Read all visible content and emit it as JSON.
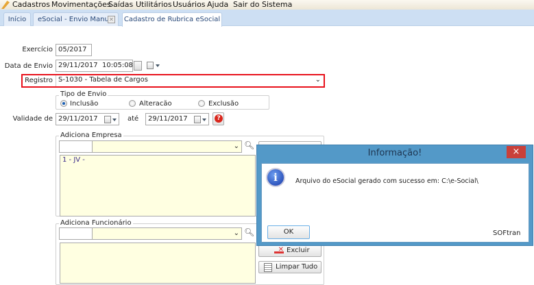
{
  "menu": [
    "Cadastros",
    "Movimentações",
    "Saídas",
    "Utilitários",
    "Usuários",
    "Ajuda",
    "Sair do Sistema"
  ],
  "tabs": [
    {
      "label": "Início"
    },
    {
      "label": "eSocial - Envio Manual"
    },
    {
      "label": "Cadastro de Rubrica eSocial"
    }
  ],
  "form": {
    "exercicio_label": "Exercício",
    "exercicio": "05/2017",
    "data_envio_label": "Data de Envio",
    "data_envio": "29/11/2017",
    "hora_envio": "10:05:08",
    "registro_label": "Registro",
    "registro": "S-1030 - Tabela de Cargos",
    "tipo_envio_label": "Tipo de Envio",
    "tipo_options": [
      "Inclusão",
      "Alteracão",
      "Exclusão"
    ],
    "validade_label": "Validade de",
    "validade_de": "29/11/2017",
    "ate_label": "até",
    "validade_ate": "29/11/2017",
    "empresa_group": "Adiciona Empresa",
    "empresa_items": [
      "1 - JV -"
    ],
    "funcionario_group": "Adiciona Funcionário",
    "excluir": "Excluir",
    "limpar": "Limpar Tudo"
  },
  "dialog": {
    "title": "Informação!",
    "message": "Arquivo do eSocial gerado com sucesso em: C:\\e-Social\\",
    "ok": "OK",
    "brand": "SOFtran",
    "close": "×"
  },
  "colors": {
    "highlight": "#e8101a",
    "dialog_frame": "#5399c8",
    "close_btn": "#c9403a"
  }
}
